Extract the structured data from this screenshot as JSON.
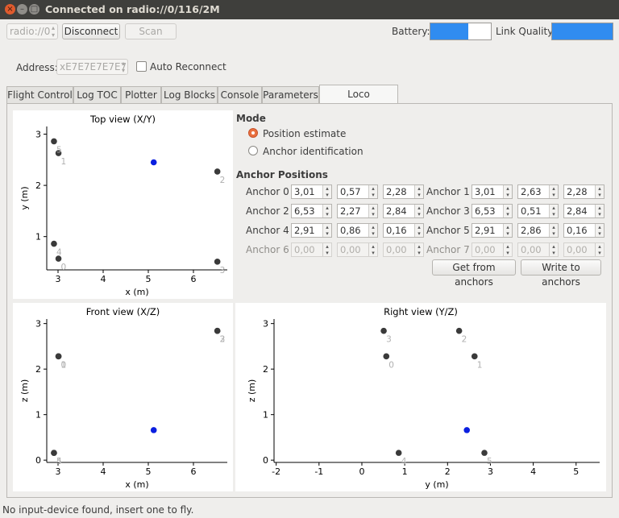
{
  "window": {
    "title": "Connected on radio://0/116/2M"
  },
  "toolbar": {
    "interface_combo": "radio://0",
    "disconnect_label": "Disconnect",
    "scan_label": "Scan",
    "battery_label": "Battery:",
    "battery_level": 0.62,
    "link_quality_label": "Link Quality:",
    "link_quality_level": 1.0,
    "address_label": "Address:",
    "address_value": "xE7E7E7E7E7",
    "auto_reconnect_label": "Auto Reconnect",
    "colors": {
      "bar_fill": "#308cf0"
    }
  },
  "tabs": [
    "Flight Control",
    "Log TOC",
    "Plotter",
    "Log Blocks",
    "Console",
    "Parameters",
    "Loco Positioning"
  ],
  "active_tab": "Loco Positioning",
  "mode": {
    "heading": "Mode",
    "options": [
      "Position estimate",
      "Anchor identification"
    ],
    "selected": "Position estimate"
  },
  "anchor_positions": {
    "heading": "Anchor Positions",
    "anchors": [
      {
        "label": "Anchor 0",
        "x": "3,01",
        "y": "0,57",
        "z": "2,28",
        "enabled": true
      },
      {
        "label": "Anchor 1",
        "x": "3,01",
        "y": "2,63",
        "z": "2,28",
        "enabled": true
      },
      {
        "label": "Anchor 2",
        "x": "6,53",
        "y": "2,27",
        "z": "2,84",
        "enabled": true
      },
      {
        "label": "Anchor 3",
        "x": "6,53",
        "y": "0,51",
        "z": "2,84",
        "enabled": true
      },
      {
        "label": "Anchor 4",
        "x": "2,91",
        "y": "0,86",
        "z": "0,16",
        "enabled": true
      },
      {
        "label": "Anchor 5",
        "x": "2,91",
        "y": "2,86",
        "z": "0,16",
        "enabled": true
      },
      {
        "label": "Anchor 6",
        "x": "0,00",
        "y": "0,00",
        "z": "0,00",
        "enabled": false
      },
      {
        "label": "Anchor 7",
        "x": "0,00",
        "y": "0,00",
        "z": "0,00",
        "enabled": false
      }
    ],
    "get_button": "Get from anchors",
    "write_button": "Write to anchors"
  },
  "chart_data": [
    {
      "type": "scatter",
      "title": "Top view (X/Y)",
      "xlabel": "x (m)",
      "ylabel": "y (m)",
      "xticks": [
        "3",
        "4",
        "5",
        "6"
      ],
      "yticks": [
        "1",
        "2",
        "3"
      ],
      "xlim": [
        2.75,
        6.75
      ],
      "ylim": [
        0.35,
        3.15
      ],
      "anchors": [
        {
          "label": "0",
          "x": 3.01,
          "y": 0.57
        },
        {
          "label": "1",
          "x": 3.01,
          "y": 2.63
        },
        {
          "label": "2",
          "x": 6.53,
          "y": 2.27
        },
        {
          "label": "3",
          "x": 6.53,
          "y": 0.51
        },
        {
          "label": "4",
          "x": 2.91,
          "y": 0.86
        },
        {
          "label": "5",
          "x": 2.91,
          "y": 2.86
        }
      ],
      "estimate": {
        "x": 5.12,
        "y": 2.45
      }
    },
    {
      "type": "scatter",
      "title": "Front view (X/Z)",
      "xlabel": "x (m)",
      "ylabel": "z (m)",
      "xticks": [
        "3",
        "4",
        "5",
        "6"
      ],
      "yticks": [
        "0",
        "1",
        "2",
        "3"
      ],
      "xlim": [
        2.75,
        6.75
      ],
      "ylim": [
        -0.05,
        3.1
      ],
      "anchors": [
        {
          "label": "0",
          "x": 3.01,
          "y": 2.28
        },
        {
          "label": "1",
          "x": 3.01,
          "y": 2.28
        },
        {
          "label": "2",
          "x": 6.53,
          "y": 2.84
        },
        {
          "label": "3",
          "x": 6.53,
          "y": 2.84
        },
        {
          "label": "4",
          "x": 2.91,
          "y": 0.16
        },
        {
          "label": "5",
          "x": 2.91,
          "y": 0.16
        }
      ],
      "estimate": {
        "x": 5.12,
        "y": 0.66
      }
    },
    {
      "type": "scatter",
      "title": "Right view (Y/Z)",
      "xlabel": "y (m)",
      "ylabel": "z (m)",
      "xticks": [
        "-2",
        "-1",
        "0",
        "1",
        "2",
        "3",
        "4",
        "5"
      ],
      "yticks": [
        "0",
        "1",
        "2",
        "3"
      ],
      "xlim": [
        -2.05,
        5.55
      ],
      "ylim": [
        -0.05,
        3.1
      ],
      "anchors": [
        {
          "label": "0",
          "x": 0.57,
          "y": 2.28
        },
        {
          "label": "1",
          "x": 2.63,
          "y": 2.28
        },
        {
          "label": "2",
          "x": 2.27,
          "y": 2.84
        },
        {
          "label": "3",
          "x": 0.51,
          "y": 2.84
        },
        {
          "label": "4",
          "x": 0.86,
          "y": 0.16
        },
        {
          "label": "5",
          "x": 2.86,
          "y": 0.16
        }
      ],
      "estimate": {
        "x": 2.45,
        "y": 0.66
      }
    }
  ],
  "status_bar": "No input-device found, insert one to fly."
}
